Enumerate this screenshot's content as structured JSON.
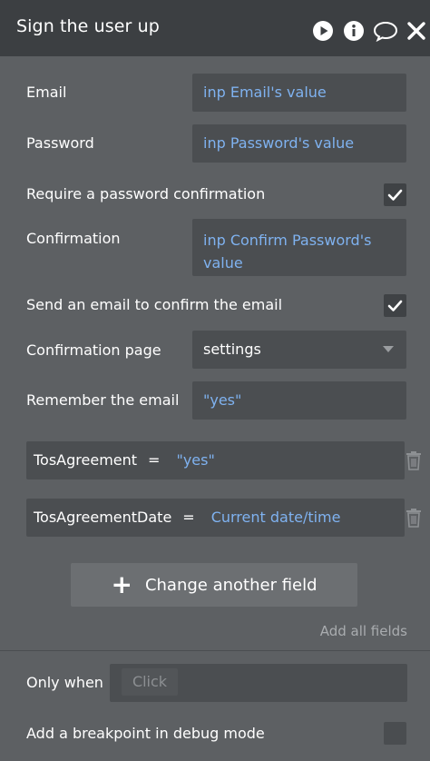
{
  "header": {
    "title": "Sign the user up",
    "icons": [
      "play-icon",
      "info-icon",
      "comment-icon",
      "close-icon"
    ]
  },
  "fields": {
    "email_label": "Email",
    "email_value": "inp Email's value",
    "password_label": "Password",
    "password_value": "inp Password's value",
    "require_confirm_label": "Require a password confirmation",
    "require_confirm_checked": true,
    "confirmation_label": "Confirmation",
    "confirmation_value_line1": "inp Confirm Password's",
    "confirmation_value_line2": "value",
    "send_email_label": "Send an email to confirm the email",
    "send_email_checked": true,
    "confirmation_page_label": "Confirmation page",
    "confirmation_page_value": "settings",
    "remember_email_label": "Remember the email",
    "remember_email_value": "\"yes\""
  },
  "changes": [
    {
      "field": "TosAgreement",
      "op": "=",
      "value": "\"yes\""
    },
    {
      "field": "TosAgreementDate",
      "op": "=",
      "value": "Current date/time"
    }
  ],
  "actions": {
    "change_another_field": "Change another field",
    "add_all_fields": "Add all fields"
  },
  "condition": {
    "only_when_label": "Only when",
    "only_when_placeholder": "Click",
    "breakpoint_label": "Add a breakpoint in debug mode",
    "breakpoint_checked": false
  },
  "colors": {
    "panel_bg": "#5d6063",
    "header_bg": "#3c3f42",
    "input_bg": "#4b4e51",
    "dynamic_value": "#7fb2f0"
  }
}
